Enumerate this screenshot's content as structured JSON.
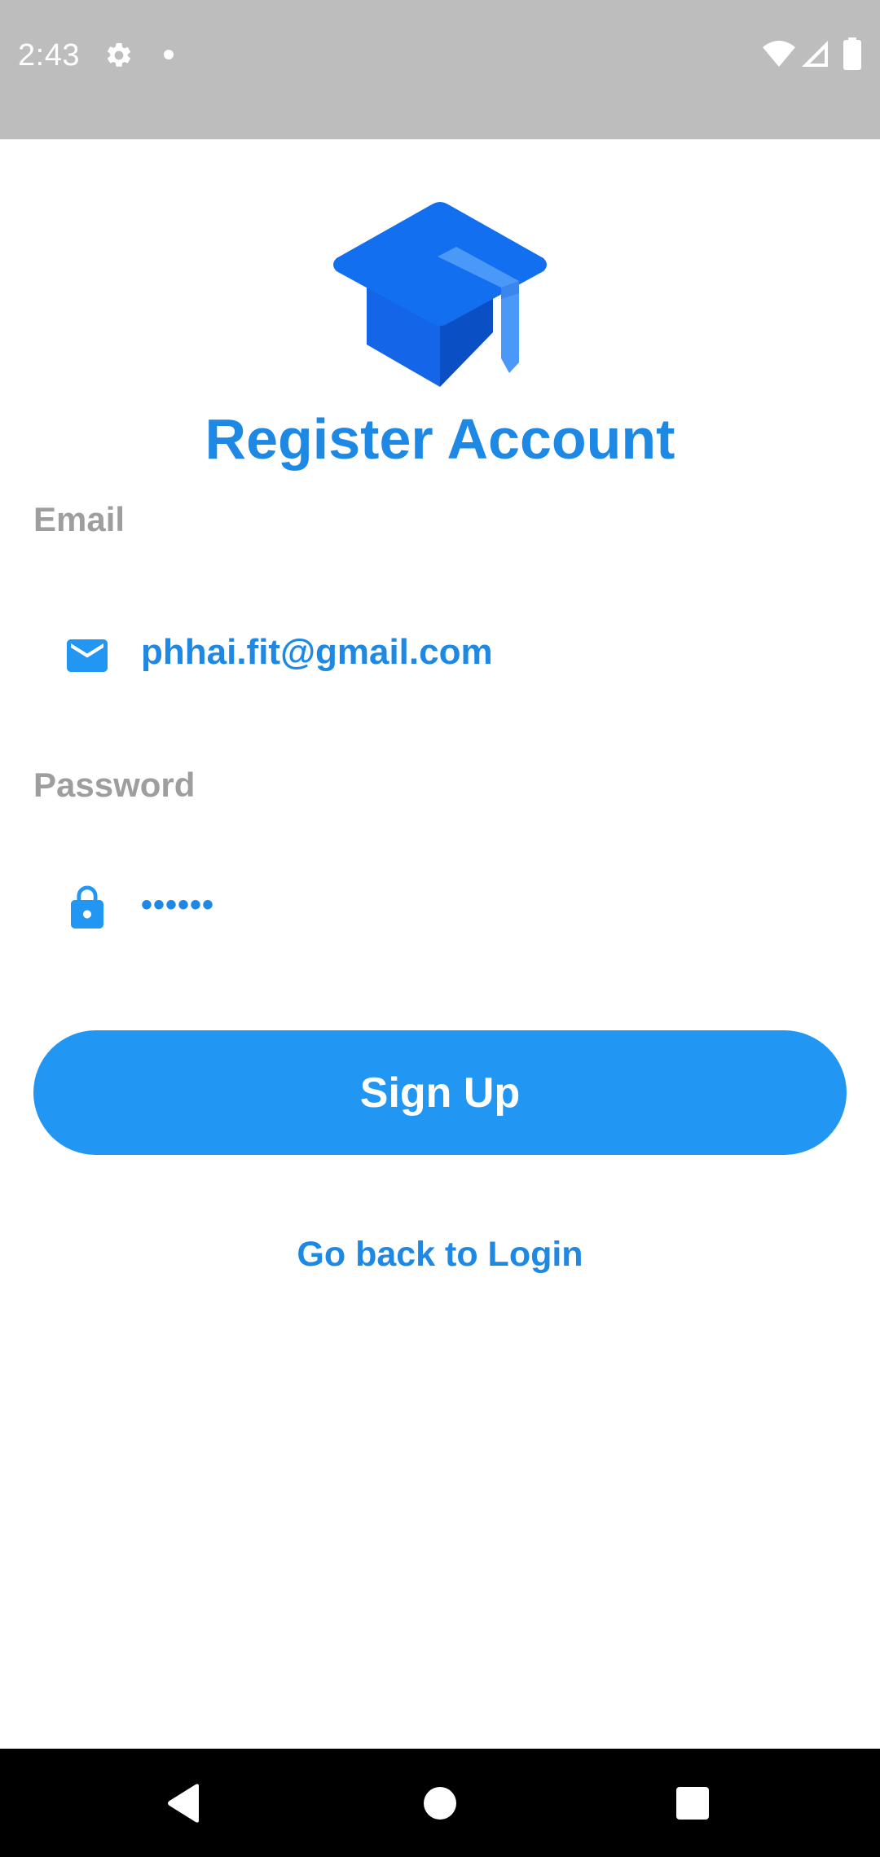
{
  "status_bar": {
    "time": "2:43",
    "icons": [
      "settings-icon",
      "notification-dot-icon",
      "wifi-icon",
      "signal-icon",
      "battery-icon"
    ]
  },
  "app": {
    "logo_icon": "graduation-cap-icon",
    "title": "Register Account",
    "accent_color": "#1e88e5",
    "button_color": "#2196f3"
  },
  "form": {
    "email_label": "Email",
    "email_icon": "mail-icon",
    "email_value": "phhai.fit@gmail.com",
    "password_label": "Password",
    "password_icon": "lock-icon",
    "password_value": "••••••",
    "signup_label": "Sign Up",
    "login_link": "Go back to Login"
  },
  "nav_bar": {
    "buttons": [
      "back-icon",
      "home-icon",
      "recents-icon"
    ]
  }
}
